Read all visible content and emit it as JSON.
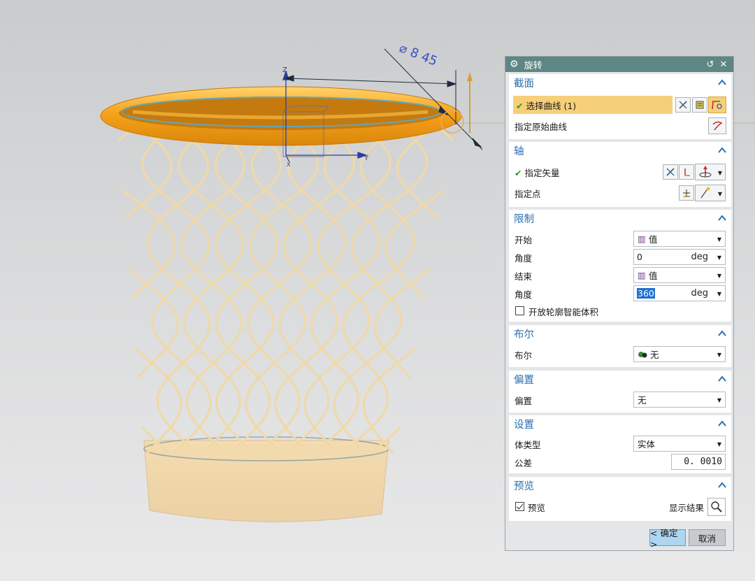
{
  "viewport": {
    "dimension_text": "⌀ 8 45",
    "axis_z": "Z",
    "axis_y": "Y",
    "axis_x": "X"
  },
  "dialog": {
    "title": "旋转",
    "sections": {
      "section": {
        "header": "截面",
        "select_curve": "选择曲线 (1)",
        "specify_original_curve": "指定原始曲线"
      },
      "axis": {
        "header": "轴",
        "specify_vector": "指定矢量",
        "specify_point": "指定点"
      },
      "limits": {
        "header": "限制",
        "start_label": "开始",
        "start_value": "值",
        "angle1_label": "角度",
        "angle1_value": "0",
        "angle1_unit": "deg",
        "end_label": "结束",
        "end_value": "值",
        "angle2_label": "角度",
        "angle2_value": "360",
        "angle2_unit": "deg",
        "open_profile_label": "开放轮廓智能体积"
      },
      "boolean": {
        "header": "布尔",
        "label": "布尔",
        "value": "无"
      },
      "offset": {
        "header": "偏置",
        "label": "偏置",
        "value": "无"
      },
      "settings": {
        "header": "设置",
        "body_type_label": "体类型",
        "body_type_value": "实体",
        "tolerance_label": "公差",
        "tolerance_value": "0. 0010"
      },
      "preview": {
        "header": "预览",
        "preview_label": "预览",
        "preview_checked": true,
        "show_result_label": "显示结果"
      }
    },
    "ok_label": "< 确定 >",
    "cancel_label": "取消"
  },
  "colors": {
    "title_bar": "#5d8684",
    "section_header": "#2a6fb0",
    "highlight": "#f6cf79",
    "rim": "#f5a623",
    "basket": "#f2dcae"
  }
}
